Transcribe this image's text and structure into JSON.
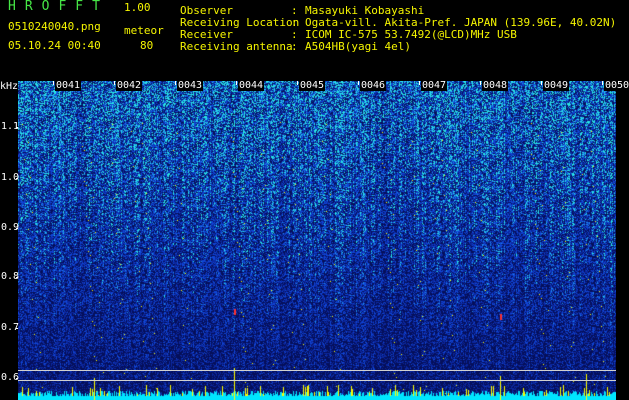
{
  "header": {
    "app_name": "HROFFT",
    "version": "1.00",
    "filename": "0510240040.png",
    "mode": "meteor",
    "datetime": "05.10.24 00:40",
    "count": "80",
    "info": [
      {
        "label": "Observer",
        "sep": ":",
        "value": "Masayuki Kobayashi"
      },
      {
        "label": "Receiving Location",
        "sep": ":",
        "value": "Ogata-vill. Akita-Pref. JAPAN (139.96E, 40.02N)"
      },
      {
        "label": "Receiver",
        "sep": ":",
        "value": "ICOM IC-575 53.7492(@LCD)MHz USB"
      },
      {
        "label": "Receiving antenna",
        "sep": ":",
        "value": "A504HB(yagi 4el)"
      }
    ]
  },
  "axis": {
    "unit": "kHz",
    "y_ticks": [
      "1.1",
      "1.0",
      "0.9",
      "0.8",
      "0.7",
      "0.6"
    ],
    "x_ticks": [
      "0041",
      "0042",
      "0043",
      "0044",
      "0045",
      "0046",
      "0047",
      "0048",
      "0049",
      "0050"
    ]
  },
  "colors": {
    "header_green": "#46e646",
    "header_yellow": "#f5f500",
    "spectrum_base": "#102c9a",
    "noise_cyan": "#00e6ff",
    "noise_yellow": "#ffff00"
  }
}
